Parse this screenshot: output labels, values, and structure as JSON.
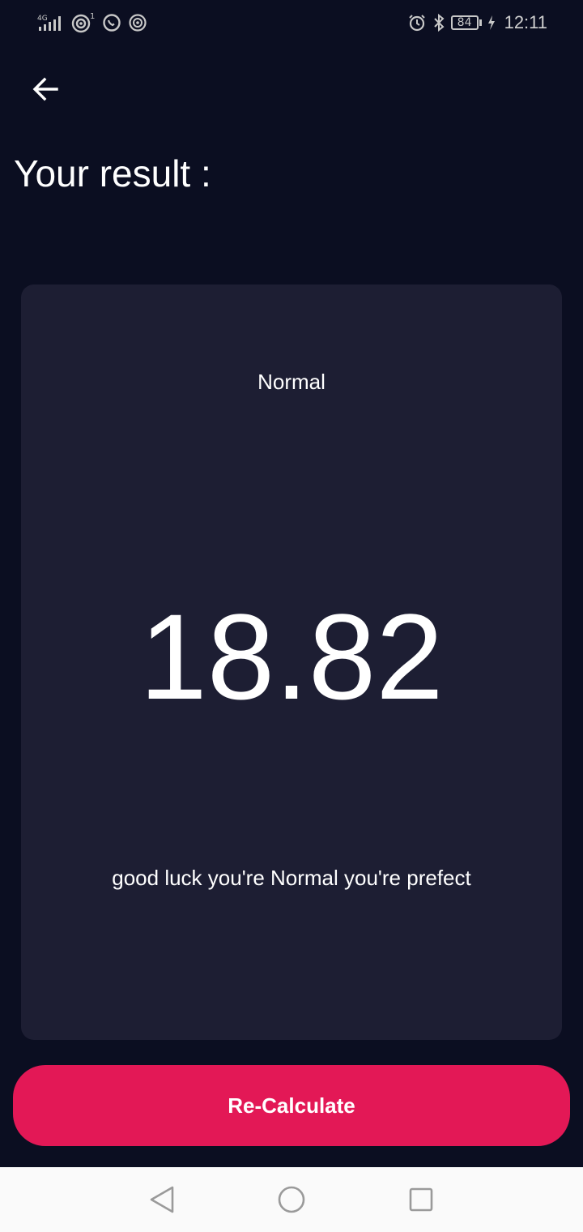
{
  "status_bar": {
    "network": "4G",
    "sim_badge": "1",
    "battery_level": "84",
    "time": "12:11",
    "icons_left": [
      "signal-icon",
      "hotspot-icon",
      "whatsapp-icon",
      "nfc-icon"
    ],
    "icons_right": [
      "alarm-icon",
      "bluetooth-icon",
      "battery-icon",
      "charging-icon"
    ]
  },
  "header": {
    "title": "Your result :"
  },
  "result": {
    "category": "Normal",
    "bmi": "18.82",
    "advice": "good luck you're Normal you're prefect"
  },
  "actions": {
    "recalculate_label": "Re-Calculate"
  },
  "colors": {
    "background": "#0b0e21",
    "card": "#1d1e33",
    "accent": "#e31856",
    "nav_bar": "#fafafa"
  }
}
